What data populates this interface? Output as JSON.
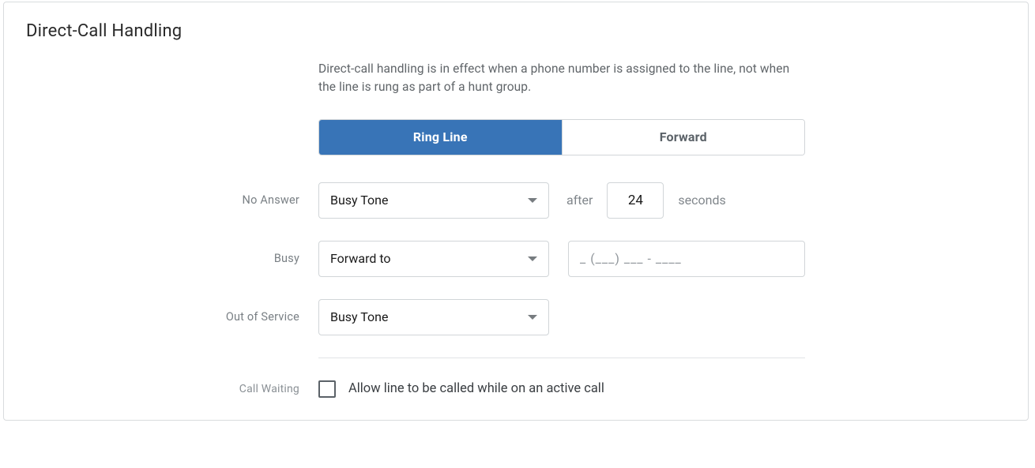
{
  "title": "Direct-Call Handling",
  "description": "Direct-call handling is in effect when a phone number is assigned to the line, not when the line is rung as part of a hunt group.",
  "tabs": [
    {
      "label": "Ring Line",
      "active": true
    },
    {
      "label": "Forward",
      "active": false
    }
  ],
  "rows": {
    "no_answer": {
      "label": "No Answer",
      "select_value": "Busy Tone",
      "after_label": "after",
      "seconds_value": "24",
      "seconds_label": "seconds"
    },
    "busy": {
      "label": "Busy",
      "select_value": "Forward to",
      "phone_placeholder": "_ (___) ___ - ____"
    },
    "out_of_service": {
      "label": "Out of Service",
      "select_value": "Busy Tone"
    }
  },
  "call_waiting": {
    "label": "Call Waiting",
    "checked": false,
    "text": "Allow line to be called while on an active call"
  }
}
